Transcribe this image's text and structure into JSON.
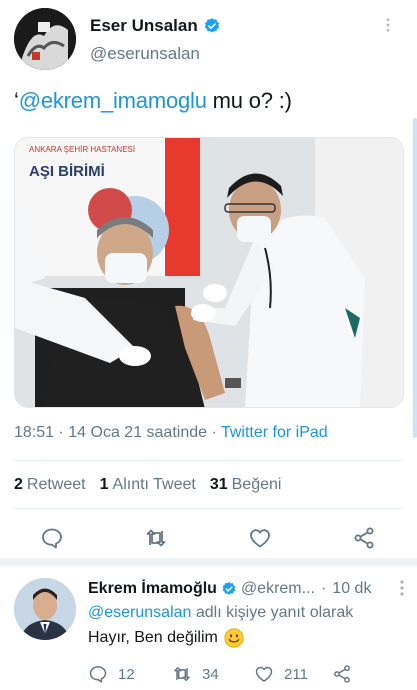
{
  "tweet": {
    "author_name": "Eser Unsalan",
    "author_handle": "@eserunsalan",
    "text_prefix": "‘",
    "text_mention": "@ekrem_imamoglu",
    "text_suffix": " mu o? :)",
    "media": {
      "sign_top": "ANKARA ŞEHİR HASTANESİ",
      "sign_main": "AŞI BİRİMİ"
    },
    "timestamp": "18:51 · 14 Oca 21 saatinde · ",
    "source": "Twitter for iPad",
    "stats": {
      "retweets_count": "2",
      "retweets_label": "Retweet",
      "quotes_count": "1",
      "quotes_label": "Alıntı Tweet",
      "likes_count": "31",
      "likes_label": "Beğeni"
    }
  },
  "reply": {
    "author_name": "Ekrem İmamoğlu",
    "author_handle": "@ekrem...",
    "separator": "·",
    "time": "10 dk",
    "reply_to_mention": "@eserunsalan",
    "reply_to_suffix": " adlı kişiye yanıt olarak",
    "text": "Hayır, Ben değilim",
    "counts": {
      "replies": "12",
      "retweets": "34",
      "likes": "211"
    }
  },
  "colors": {
    "accent": "#1b95e0",
    "muted": "#657786",
    "text": "#14171a",
    "verified": "#1da1f2"
  },
  "icons": [
    "verified-badge-icon",
    "chevron-down-icon",
    "reply-icon",
    "retweet-icon",
    "like-icon",
    "share-icon",
    "smiling-face-emoji"
  ]
}
